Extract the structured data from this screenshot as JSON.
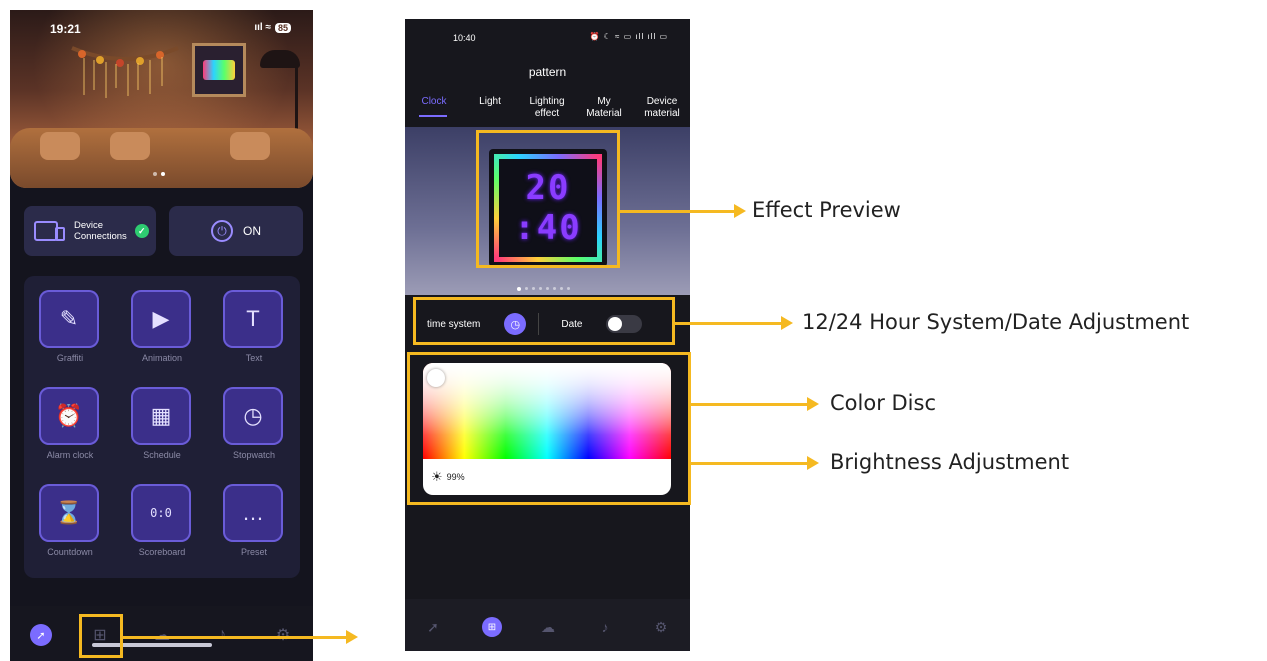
{
  "phone1": {
    "status_time": "19:21",
    "status_icons": "ııl ≈",
    "battery": "85",
    "device_connections_label": "Device\nConnections",
    "power_label": "ON",
    "tiles": [
      {
        "label": "Graffiti",
        "icon": "palette-icon",
        "glyph": "✎"
      },
      {
        "label": "Animation",
        "icon": "film-icon",
        "glyph": "▶"
      },
      {
        "label": "Text",
        "icon": "text-icon",
        "glyph": "T"
      },
      {
        "label": "Alarm clock",
        "icon": "alarm-clock-icon",
        "glyph": "⏰"
      },
      {
        "label": "Schedule",
        "icon": "calendar-icon",
        "glyph": "▦"
      },
      {
        "label": "Stopwatch",
        "icon": "stopwatch-icon",
        "glyph": "◷"
      },
      {
        "label": "Countdown",
        "icon": "hourglass-icon",
        "glyph": "⌛"
      },
      {
        "label": "Scoreboard",
        "icon": "scoreboard-icon",
        "glyph": "0:0"
      },
      {
        "label": "Preset",
        "icon": "chat-bubble-icon",
        "glyph": "…"
      }
    ]
  },
  "phone2": {
    "status_time": "10:40",
    "status_icons": "⏰ ☾ ≈ ▭ ıll ıll ▭",
    "title": "pattern",
    "tabs": [
      {
        "label": "Clock",
        "active": true
      },
      {
        "label": "Light",
        "active": false
      },
      {
        "label": "Lighting\neffect",
        "active": false
      },
      {
        "label": "My\nMaterial",
        "active": false
      },
      {
        "label": "Device\nmaterial",
        "active": false
      }
    ],
    "clock_hours": "20",
    "clock_minutes": ":40",
    "time_system_label": "time system",
    "date_label": "Date",
    "brightness_value": "99%"
  },
  "callouts": {
    "effect_preview": "Effect Preview",
    "hour_system": "12/24 Hour System/Date Adjustment",
    "color_disc": "Color Disc",
    "brightness": "Brightness Adjustment"
  },
  "colors": {
    "accent": "#7b6cff",
    "highlight": "#f5b921",
    "dark_bg": "#14141e"
  }
}
